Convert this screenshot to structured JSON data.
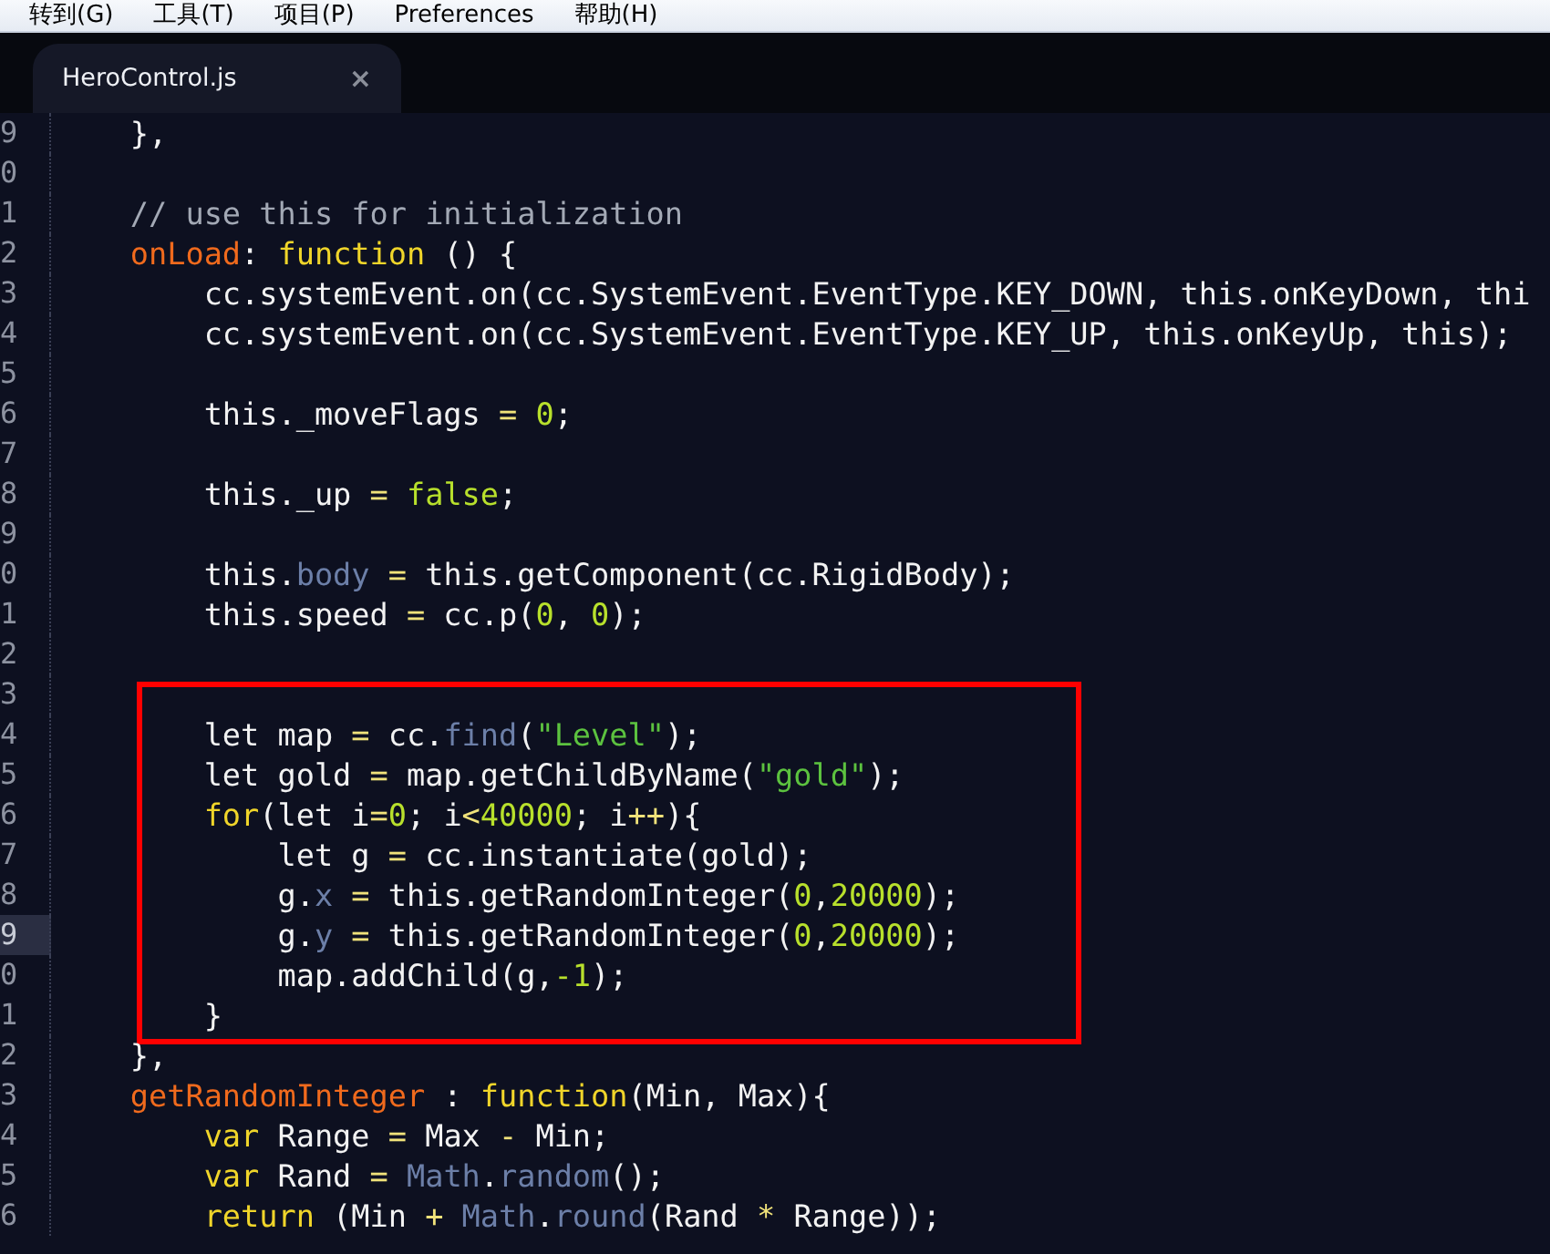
{
  "menu_bar": {
    "items": [
      "转到(G)",
      "工具(T)",
      "项目(P)",
      "Preferences",
      "帮助(H)"
    ]
  },
  "tabs": [
    {
      "label": "HeroControl.js",
      "close": "×",
      "selected": true
    }
  ],
  "editor": {
    "blocks": [
      {
        "boxed": false,
        "lines": [
          {
            "number": "9",
            "current": false,
            "tokens": [
              {
                "text": "    },",
                "kind": "plain"
              }
            ]
          },
          {
            "number": "0",
            "current": false
          },
          {
            "number": "1",
            "current": false,
            "tokens": [
              {
                "text": "    // use this for initialization",
                "kind": "comment"
              }
            ]
          },
          {
            "number": "2",
            "current": false,
            "tokens": [
              {
                "text": "    onLoad",
                "kind": "key"
              },
              {
                "text": ": ",
                "kind": "plain"
              },
              {
                "text": "function",
                "kind": "keyword"
              },
              {
                "text": " () {",
                "kind": "plain"
              }
            ]
          },
          {
            "number": "3",
            "current": false,
            "tokens": [
              {
                "text": "        cc.systemEvent.on(cc.SystemEvent.EventType.KEY_DOWN, this.onKeyDown, thi",
                "kind": "plain"
              }
            ]
          },
          {
            "number": "4",
            "current": false,
            "tokens": [
              {
                "text": "        cc.systemEvent.on(cc.SystemEvent.EventType.KEY_UP, this.onKeyUp, this);",
                "kind": "plain"
              }
            ]
          },
          {
            "number": "5",
            "current": false
          },
          {
            "number": "6",
            "current": false,
            "tokens": [
              {
                "text": "        this._moveFlags ",
                "kind": "plain"
              },
              {
                "text": "= ",
                "kind": "op"
              },
              {
                "text": "0",
                "kind": "number"
              },
              {
                "text": ";",
                "kind": "plain"
              }
            ]
          },
          {
            "number": "7",
            "current": false
          },
          {
            "number": "8",
            "current": false,
            "tokens": [
              {
                "text": "        this._up ",
                "kind": "plain"
              },
              {
                "text": "= ",
                "kind": "op"
              },
              {
                "text": "false",
                "kind": "number"
              },
              {
                "text": ";",
                "kind": "plain"
              }
            ]
          },
          {
            "number": "9",
            "current": false
          },
          {
            "number": "0",
            "current": false,
            "tokens": [
              {
                "text": "        this.",
                "kind": "plain"
              },
              {
                "text": "body ",
                "kind": "member"
              },
              {
                "text": "=",
                "kind": "op"
              },
              {
                "text": " this.getComponent(cc.RigidBody);",
                "kind": "plain"
              }
            ]
          },
          {
            "number": "1",
            "current": false,
            "tokens": [
              {
                "text": "        this.speed ",
                "kind": "plain"
              },
              {
                "text": "=",
                "kind": "op"
              },
              {
                "text": " cc.p(",
                "kind": "plain"
              },
              {
                "text": "0",
                "kind": "number"
              },
              {
                "text": ", ",
                "kind": "plain"
              },
              {
                "text": "0",
                "kind": "number"
              },
              {
                "text": ");",
                "kind": "plain"
              }
            ]
          },
          {
            "number": "2",
            "current": false
          }
        ]
      },
      {
        "boxed": true,
        "lines": [
          {
            "number": "3",
            "current": false
          },
          {
            "number": "4",
            "current": false,
            "tokens": [
              {
                "text": "        let map ",
                "kind": "plain"
              },
              {
                "text": "=",
                "kind": "op"
              },
              {
                "text": " cc.",
                "kind": "plain"
              },
              {
                "text": "find",
                "kind": "member"
              },
              {
                "text": "(",
                "kind": "plain"
              },
              {
                "text": "\"Level\"",
                "kind": "string"
              },
              {
                "text": ");",
                "kind": "plain"
              }
            ]
          },
          {
            "number": "5",
            "current": false,
            "tokens": [
              {
                "text": "        let gold ",
                "kind": "plain"
              },
              {
                "text": "=",
                "kind": "op"
              },
              {
                "text": " map.getChildByName(",
                "kind": "plain"
              },
              {
                "text": "\"gold\"",
                "kind": "string"
              },
              {
                "text": ");",
                "kind": "plain"
              }
            ]
          },
          {
            "number": "6",
            "current": false,
            "tokens": [
              {
                "text": "        for",
                "kind": "keyword"
              },
              {
                "text": "(let i",
                "kind": "plain"
              },
              {
                "text": "=",
                "kind": "op"
              },
              {
                "text": "0",
                "kind": "number"
              },
              {
                "text": "; i",
                "kind": "plain"
              },
              {
                "text": "<",
                "kind": "op"
              },
              {
                "text": "40000",
                "kind": "number"
              },
              {
                "text": "; i",
                "kind": "plain"
              },
              {
                "text": "++",
                "kind": "op"
              },
              {
                "text": "){",
                "kind": "plain"
              }
            ]
          },
          {
            "number": "7",
            "current": false,
            "tokens": [
              {
                "text": "            let g ",
                "kind": "plain"
              },
              {
                "text": "=",
                "kind": "op"
              },
              {
                "text": " cc.instantiate(gold);",
                "kind": "plain"
              }
            ]
          },
          {
            "number": "8",
            "current": false,
            "tokens": [
              {
                "text": "            g.",
                "kind": "plain"
              },
              {
                "text": "x ",
                "kind": "member"
              },
              {
                "text": "=",
                "kind": "op"
              },
              {
                "text": " this.getRandomInteger(",
                "kind": "plain"
              },
              {
                "text": "0",
                "kind": "number"
              },
              {
                "text": ",",
                "kind": "plain"
              },
              {
                "text": "20000",
                "kind": "number"
              },
              {
                "text": ");",
                "kind": "plain"
              }
            ]
          },
          {
            "number": "9",
            "current": true,
            "tokens": [
              {
                "text": "            g.",
                "kind": "plain"
              },
              {
                "text": "y ",
                "kind": "member"
              },
              {
                "text": "=",
                "kind": "op"
              },
              {
                "text": " this.getRandomInteger(",
                "kind": "plain"
              },
              {
                "text": "0",
                "kind": "number"
              },
              {
                "text": ",",
                "kind": "plain"
              },
              {
                "text": "20000",
                "kind": "number"
              },
              {
                "text": ");",
                "kind": "plain"
              }
            ]
          },
          {
            "number": "0",
            "current": false,
            "tokens": [
              {
                "text": "            map.addChild(g,",
                "kind": "plain"
              },
              {
                "text": "-1",
                "kind": "number"
              },
              {
                "text": ");",
                "kind": "plain"
              }
            ]
          },
          {
            "number": "1",
            "current": false,
            "tokens": [
              {
                "text": "        }",
                "kind": "plain"
              }
            ]
          }
        ]
      },
      {
        "boxed": false,
        "lines": [
          {
            "number": "2",
            "current": false,
            "tokens": [
              {
                "text": "    },",
                "kind": "plain"
              }
            ]
          },
          {
            "number": "3",
            "current": false,
            "tokens": [
              {
                "text": "    getRandomInteger",
                "kind": "key"
              },
              {
                "text": " : ",
                "kind": "plain"
              },
              {
                "text": "function",
                "kind": "keyword"
              },
              {
                "text": "(Min, Max){",
                "kind": "plain"
              }
            ]
          },
          {
            "number": "4",
            "current": false,
            "tokens": [
              {
                "text": "        var",
                "kind": "keyword"
              },
              {
                "text": " Range ",
                "kind": "plain"
              },
              {
                "text": "=",
                "kind": "op"
              },
              {
                "text": " Max ",
                "kind": "plain"
              },
              {
                "text": "-",
                "kind": "op"
              },
              {
                "text": " Min;",
                "kind": "plain"
              }
            ]
          },
          {
            "number": "5",
            "current": false,
            "tokens": [
              {
                "text": "        var",
                "kind": "keyword"
              },
              {
                "text": " Rand ",
                "kind": "plain"
              },
              {
                "text": "= ",
                "kind": "op"
              },
              {
                "text": "Math",
                "kind": "member"
              },
              {
                "text": ".",
                "kind": "plain"
              },
              {
                "text": "random",
                "kind": "member"
              },
              {
                "text": "();",
                "kind": "plain"
              }
            ]
          },
          {
            "number": "6",
            "current": false,
            "tokens": [
              {
                "text": "        return",
                "kind": "keyword"
              },
              {
                "text": " (Min ",
                "kind": "plain"
              },
              {
                "text": "+ ",
                "kind": "op"
              },
              {
                "text": "Math",
                "kind": "member"
              },
              {
                "text": ".",
                "kind": "plain"
              },
              {
                "text": "round",
                "kind": "member"
              },
              {
                "text": "(Rand ",
                "kind": "plain"
              },
              {
                "text": "*",
                "kind": "op"
              },
              {
                "text": " Range));",
                "kind": "plain"
              }
            ]
          }
        ]
      }
    ]
  }
}
